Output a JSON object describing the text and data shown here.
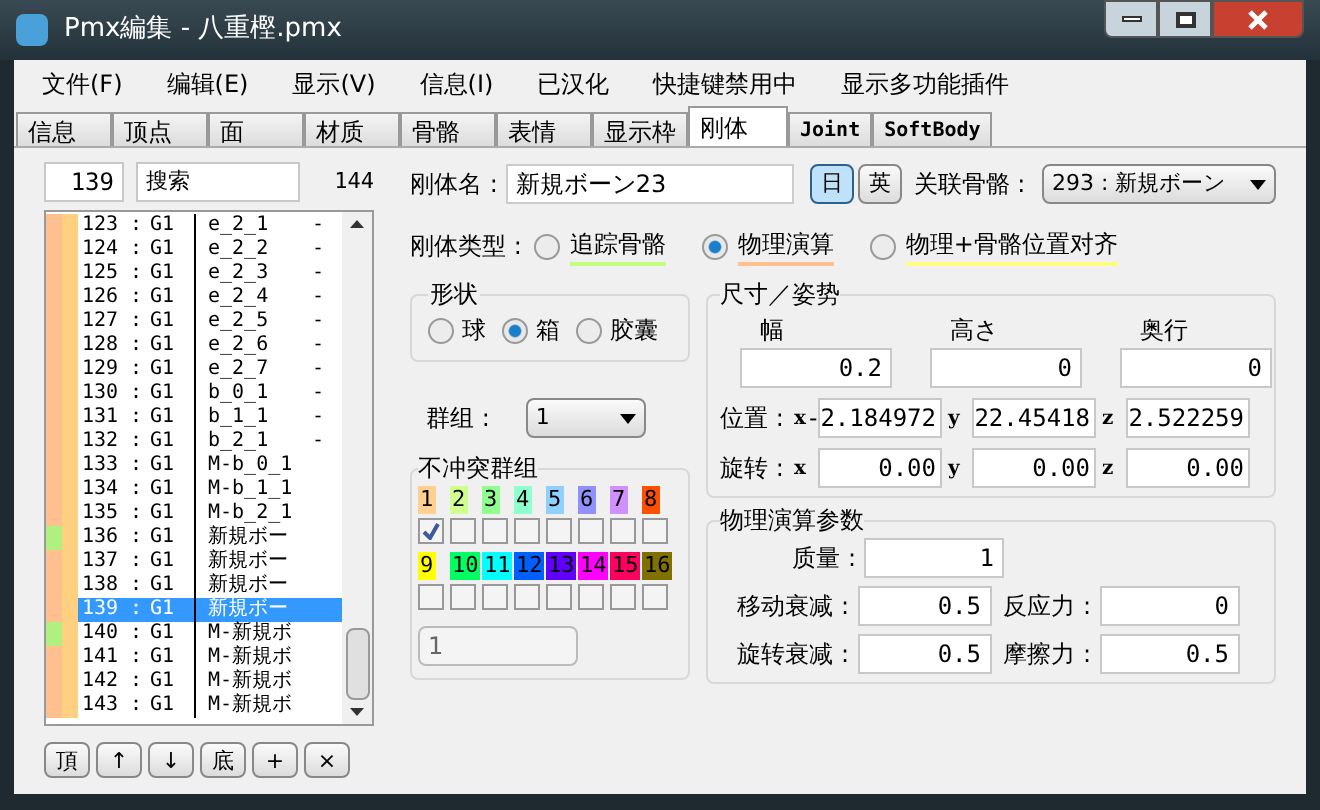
{
  "window": {
    "title": "Pmx編集 - 八重樫.pmx"
  },
  "menu": [
    "文件(F)",
    "编辑(E)",
    "显示(V)",
    "信息(I)",
    "已汉化",
    "快捷键禁用中",
    "显示多功能插件"
  ],
  "tabs": [
    {
      "label": "信息",
      "selected": false
    },
    {
      "label": "顶点",
      "selected": false
    },
    {
      "label": "面",
      "selected": false
    },
    {
      "label": "材质",
      "selected": false
    },
    {
      "label": "骨骼",
      "selected": false
    },
    {
      "label": "表情",
      "selected": false
    },
    {
      "label": "显示枠",
      "selected": false
    },
    {
      "label": "刚体",
      "selected": true
    },
    {
      "label": "Joint",
      "selected": false
    },
    {
      "label": "SoftBody",
      "selected": false
    }
  ],
  "list_panel": {
    "index_value": "139",
    "search_value": "搜索",
    "count": "144",
    "separator": ":",
    "rows": [
      {
        "index": "123",
        "group": "G1",
        "name": "e_2_1",
        "mark": "-",
        "color": "#ffc090",
        "selected": false
      },
      {
        "index": "124",
        "group": "G1",
        "name": "e_2_2",
        "mark": "-",
        "color": "#ffc090",
        "selected": false
      },
      {
        "index": "125",
        "group": "G1",
        "name": "e_2_3",
        "mark": "-",
        "color": "#ffc090",
        "selected": false
      },
      {
        "index": "126",
        "group": "G1",
        "name": "e_2_4",
        "mark": "-",
        "color": "#ffc090",
        "selected": false
      },
      {
        "index": "127",
        "group": "G1",
        "name": "e_2_5",
        "mark": "-",
        "color": "#ffc090",
        "selected": false
      },
      {
        "index": "128",
        "group": "G1",
        "name": "e_2_6",
        "mark": "-",
        "color": "#ffc090",
        "selected": false
      },
      {
        "index": "129",
        "group": "G1",
        "name": "e_2_7",
        "mark": "-",
        "color": "#ffc090",
        "selected": false
      },
      {
        "index": "130",
        "group": "G1",
        "name": "b_0_1",
        "mark": "-",
        "color": "#ffc090",
        "selected": false
      },
      {
        "index": "131",
        "group": "G1",
        "name": "b_1_1",
        "mark": "-",
        "color": "#ffc090",
        "selected": false
      },
      {
        "index": "132",
        "group": "G1",
        "name": "b_2_1",
        "mark": "-",
        "color": "#ffc090",
        "selected": false
      },
      {
        "index": "133",
        "group": "G1",
        "name": "M-b_0_1",
        "color": "#ffc090",
        "selected": false
      },
      {
        "index": "134",
        "group": "G1",
        "name": "M-b_1_1",
        "color": "#ffc090",
        "selected": false
      },
      {
        "index": "135",
        "group": "G1",
        "name": "M-b_2_1",
        "color": "#ffc090",
        "selected": false
      },
      {
        "index": "136",
        "group": "G1",
        "name": "新規ボー",
        "color": "#b0f080",
        "selected": false
      },
      {
        "index": "137",
        "group": "G1",
        "name": "新規ボー",
        "color": "#ffc090",
        "selected": false
      },
      {
        "index": "138",
        "group": "G1",
        "name": "新規ボー",
        "color": "#ffc090",
        "selected": false
      },
      {
        "index": "139",
        "group": "G1",
        "name": "新規ボー",
        "color": "#ffc090",
        "selected": true
      },
      {
        "index": "140",
        "group": "G1",
        "name": "M-新規ボ",
        "color": "#b0f080",
        "selected": false
      },
      {
        "index": "141",
        "group": "G1",
        "name": "M-新規ボ",
        "color": "#ffc090",
        "selected": false
      },
      {
        "index": "142",
        "group": "G1",
        "name": "M-新規ボ",
        "color": "#ffc090",
        "selected": false
      },
      {
        "index": "143",
        "group": "G1",
        "name": "M-新規ボ",
        "color": "#ffc090",
        "selected": false
      }
    ],
    "buttons": [
      "頂",
      "↑",
      "↓",
      "底",
      "+",
      "×"
    ]
  },
  "body_name": {
    "label": "刚体名 :",
    "value": "新規ボーン23"
  },
  "lang_buttons": [
    {
      "label": "日",
      "selected": true
    },
    {
      "label": "英",
      "selected": false
    }
  ],
  "bone": {
    "label": "关联骨骼 :",
    "value": "293 : 新規ボーン"
  },
  "body_type": {
    "label": "刚体类型 :",
    "options": [
      {
        "label": "追踪骨骼",
        "color": "#c0ff80",
        "selected": false
      },
      {
        "label": "物理演算",
        "color": "#ffc090",
        "selected": true
      },
      {
        "label": "物理+骨骼位置对齐",
        "color": "#ffff80",
        "selected": false
      }
    ]
  },
  "shape": {
    "title": "形状",
    "options": [
      {
        "label": "球",
        "selected": false
      },
      {
        "label": "箱",
        "selected": true
      },
      {
        "label": "胶囊",
        "selected": false
      }
    ]
  },
  "group": {
    "label": "群组 :",
    "value": "1"
  },
  "no_collision": {
    "title": "不冲突群组",
    "value": "1",
    "groups": [
      {
        "label": "1",
        "color": "#ffd090",
        "checked": true
      },
      {
        "label": "2",
        "color": "#d0ff90",
        "checked": false
      },
      {
        "label": "3",
        "color": "#90ff90",
        "checked": false
      },
      {
        "label": "4",
        "color": "#90ffd0",
        "checked": false
      },
      {
        "label": "5",
        "color": "#90d0ff",
        "checked": false
      },
      {
        "label": "6",
        "color": "#9090ff",
        "checked": false
      },
      {
        "label": "7",
        "color": "#d090ff",
        "checked": false
      },
      {
        "label": "8",
        "color": "#ff5000",
        "checked": false
      },
      {
        "label": "9",
        "color": "#ffff00",
        "checked": false
      },
      {
        "label": "10",
        "color": "#00ff60",
        "checked": false
      },
      {
        "label": "11",
        "color": "#00ffff",
        "checked": false
      },
      {
        "label": "12",
        "color": "#0060ff",
        "checked": false
      },
      {
        "label": "13",
        "color": "#6000ff",
        "checked": false
      },
      {
        "label": "14",
        "color": "#ff00ff",
        "checked": false
      },
      {
        "label": "15",
        "color": "#ff0060",
        "checked": false
      },
      {
        "label": "16",
        "color": "#807000",
        "checked": false
      }
    ]
  },
  "size_pose": {
    "title": "尺寸／姿势",
    "size_labels": [
      "幅",
      "高さ",
      "奥行"
    ],
    "size_values": [
      "0.2",
      "0",
      "0"
    ],
    "rows": [
      {
        "label": "位置 :",
        "axes": [
          "x",
          "y",
          "z"
        ],
        "values": [
          "-2.184972",
          "22.45418",
          "2.522259"
        ]
      },
      {
        "label": "旋转 :",
        "axes": [
          "x",
          "y",
          "z"
        ],
        "values": [
          "0.00",
          "0.00",
          "0.00"
        ]
      }
    ]
  },
  "physics": {
    "title": "物理演算参数",
    "mass": {
      "label": "质量 :",
      "value": "1"
    },
    "params": [
      {
        "label": "移动衰减 :",
        "value": "0.5"
      },
      {
        "label": "反应力 :",
        "value": "0"
      },
      {
        "label": "旋转衰减 :",
        "value": "0.5"
      },
      {
        "label": "摩擦力 :",
        "value": "0.5"
      }
    ]
  }
}
